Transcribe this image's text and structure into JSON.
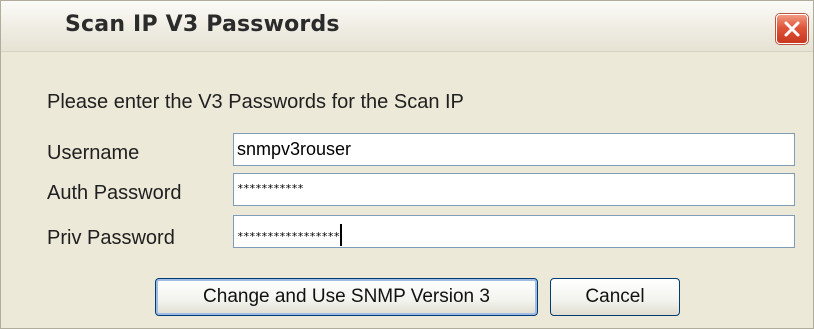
{
  "dialog": {
    "title": "Scan IP V3 Passwords",
    "instruction": "Please enter the V3 Passwords for the Scan IP",
    "fields": [
      {
        "label": "Username",
        "value": "snmpv3rouser"
      },
      {
        "label": "Auth Password",
        "value": "***********"
      },
      {
        "label": "Priv Password",
        "value": "*****************"
      }
    ],
    "buttons": {
      "confirm_label": "Change and Use SNMP Version 3",
      "cancel_label": "Cancel"
    }
  },
  "icons": {
    "close": "close-icon"
  },
  "colors": {
    "dialog_background": "#ece9d8",
    "close_button": "#e0553a",
    "field_border": "#7f9db9",
    "button_border": "#003c74"
  }
}
